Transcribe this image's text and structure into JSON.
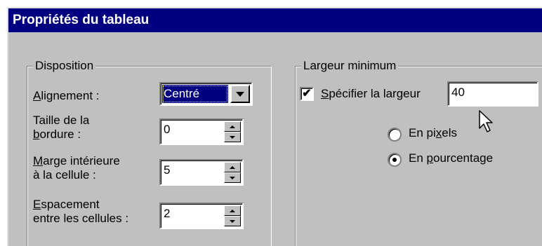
{
  "dialog": {
    "title": "Propriétés du tableau"
  },
  "disposition": {
    "group_label": "Disposition",
    "alignment": {
      "label_prefix": "",
      "label_mnemonic": "A",
      "label_rest": "lignement :",
      "value": "Centré"
    },
    "border": {
      "line1": "Taille de la",
      "line2_mnemonic": "b",
      "line2_rest": "ordure :",
      "value": "0"
    },
    "padding": {
      "line1_mnemonic": "M",
      "line1_rest": "arge intérieure",
      "line2": "à la cellule :",
      "value": "5"
    },
    "spacing": {
      "line1_mnemonic": "E",
      "line1_rest": "spacement",
      "line2": "entre les cellules :",
      "value": "2"
    }
  },
  "min_width": {
    "group_label": "Largeur minimum",
    "specify": {
      "label_mnemonic": "S",
      "label_rest": "pécifier la largeur",
      "checked": true,
      "check_glyph": "✔",
      "value": "40"
    },
    "pixels": {
      "label_a": "En pi",
      "label_mnemonic": "x",
      "label_b": "els",
      "selected": false
    },
    "percent": {
      "label_a": "En ",
      "label_mnemonic": "p",
      "label_b": "ourcentage",
      "selected": true
    }
  },
  "icons": {
    "cursor": "mouse-pointer-icon"
  },
  "colors": {
    "titlebar": "#000080",
    "face": "#c0c0c0",
    "selection": "#000080"
  }
}
